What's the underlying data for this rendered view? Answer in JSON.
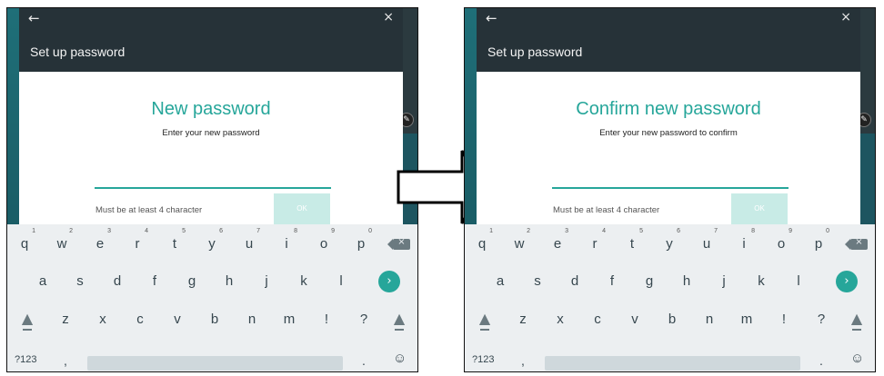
{
  "screens": [
    {
      "header_title": "Set up password",
      "big_title": "New password",
      "subtitle": "Enter your new password",
      "hint": "Must be at least 4 character",
      "ok_label": "OK"
    },
    {
      "header_title": "Set up password",
      "big_title": "Confirm new password",
      "subtitle": "Enter your new password to confirm",
      "hint": "Must be at least 4 character",
      "ok_label": "OK"
    }
  ],
  "keyboard": {
    "row1": [
      "q",
      "w",
      "e",
      "r",
      "t",
      "y",
      "u",
      "i",
      "o",
      "p"
    ],
    "row1_hints": [
      "1",
      "2",
      "3",
      "4",
      "5",
      "6",
      "7",
      "8",
      "9",
      "0"
    ],
    "row2": [
      "a",
      "s",
      "d",
      "f",
      "g",
      "h",
      "j",
      "k",
      "l"
    ],
    "row3": [
      "z",
      "x",
      "c",
      "v",
      "b",
      "n",
      "m",
      "!",
      "?"
    ],
    "symbols_label": "?123",
    "comma": ",",
    "period": ".",
    "emoji": "☺"
  },
  "icons": {
    "back": "arrow-left-icon",
    "close": "close-icon",
    "edit": "edit-pencil-icon",
    "enter": "chevron-right-icon",
    "backspace": "backspace-icon",
    "shift": "shift-up-arrow-icon",
    "transition": "right-arrow-icon"
  },
  "colors": {
    "accent": "#26a69a",
    "header": "#263238",
    "ok_button": "#c8ebe6",
    "keyboard_bg": "#eceff1"
  }
}
